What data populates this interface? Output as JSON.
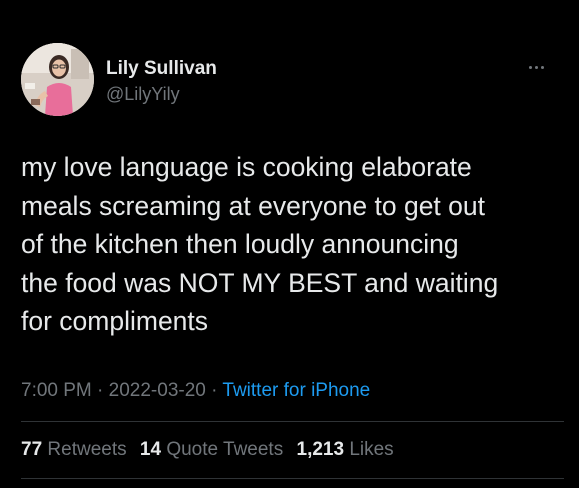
{
  "user": {
    "display_name": "Lily Sullivan",
    "handle": "@LilyYily",
    "avatar_icon": "profile-photo"
  },
  "tweet": {
    "text": "my love language is cooking elaborate\nmeals screaming at everyone to get out\nof the kitchen then loudly announcing\nthe food was NOT MY BEST and waiting\nfor compliments",
    "time": "7:00 PM",
    "separator": "·",
    "date": "2022-03-20",
    "source": "Twitter for iPhone"
  },
  "stats": {
    "retweets_count": "77",
    "retweets_label": "Retweets",
    "quote_count": "14",
    "quote_label": "Quote Tweets",
    "likes_count": "1,213",
    "likes_label": "Likes"
  },
  "colors": {
    "background": "#000000",
    "text_primary": "#e7e9ea",
    "text_secondary": "#71767b",
    "link": "#1d9bf0",
    "divider": "#2f3336"
  }
}
